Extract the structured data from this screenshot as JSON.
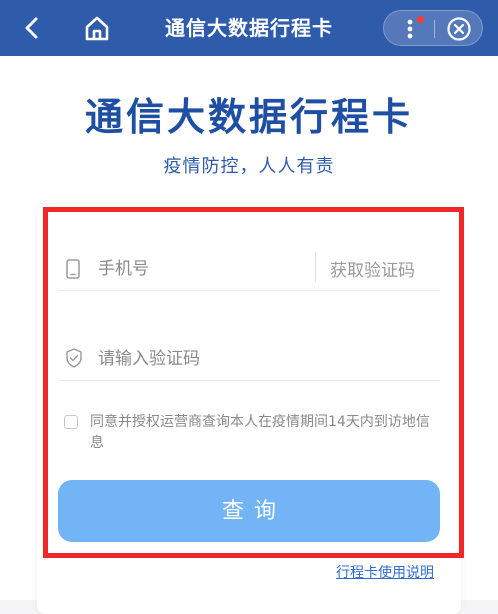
{
  "header": {
    "title": "通信大数据行程卡",
    "icons": {
      "back": "back-arrow-icon",
      "home": "home-icon",
      "more": "more-dots-icon",
      "close": "close-circle-icon"
    },
    "notification_dot_color": "#ff3b30",
    "background": "#2f5bab"
  },
  "main": {
    "title": "通信大数据行程卡",
    "subtitle": "疫情防控，人人有责"
  },
  "form": {
    "phone": {
      "placeholder": "手机号",
      "icon": "phone-icon"
    },
    "get_code_label": "获取验证码",
    "code": {
      "placeholder": "请输入验证码",
      "icon": "shield-icon"
    },
    "agreement_text": "同意并授权运营商查询本人在疫情期间14天内到访地信息",
    "agreement_checked": false,
    "submit_label": "查询",
    "submit_color": "#73b4f6",
    "highlight_color": "#f0262b"
  },
  "footer": {
    "guide_link": "行程卡使用说明"
  }
}
